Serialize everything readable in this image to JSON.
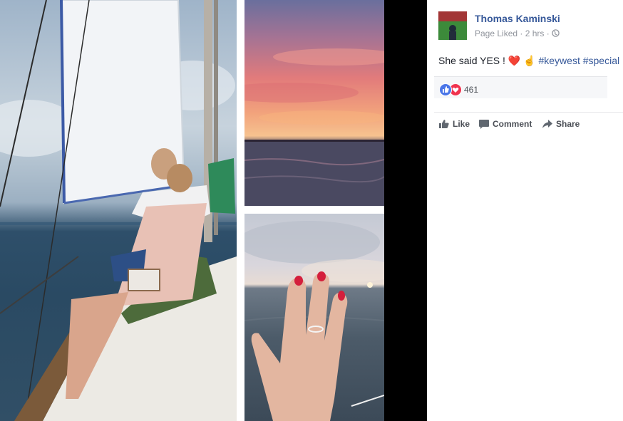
{
  "post": {
    "author": "Thomas Kaminski",
    "meta": "Page Liked · 2 hrs ·",
    "text_main": "She said YES ! ",
    "text_emojis": "❤️ ☝",
    "hashtags": [
      "#keywest",
      "#special"
    ],
    "reaction_count": "461"
  },
  "actions": {
    "like": "Like",
    "comment": "Comment",
    "share": "Share"
  },
  "icons": {
    "privacy": "globe-icon",
    "reactions": [
      "like-reaction-icon",
      "love-reaction-icon"
    ]
  },
  "colors": {
    "link": "#365899",
    "like_blue": "#4a76e8",
    "love_red": "#f0334e"
  }
}
